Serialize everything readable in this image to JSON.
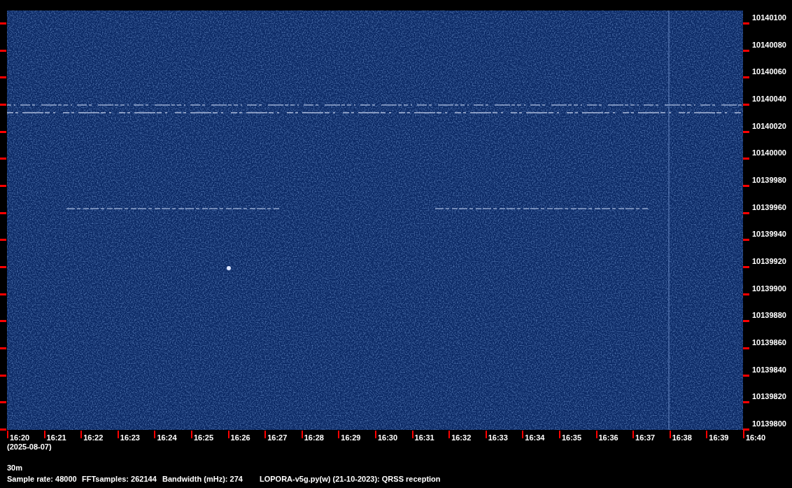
{
  "frequency_labels": [
    "10140100",
    "10140080",
    "10140060",
    "10140040",
    "10140020",
    "10140000",
    "10139980",
    "10139960",
    "10139940",
    "10139920",
    "10139900",
    "10139880",
    "10139860",
    "10139840",
    "10139820",
    "10139800"
  ],
  "time_labels": [
    "16:20",
    "16:21",
    "16:22",
    "16:23",
    "16:24",
    "16:25",
    "16:26",
    "16:27",
    "16:28",
    "16:29",
    "16:30",
    "16:31",
    "16:32",
    "16:33",
    "16:34",
    "16:35",
    "16:36",
    "16:37",
    "16:38",
    "16:39",
    "16:40"
  ],
  "date": "(2025-08-07)",
  "band": "30m",
  "info": [
    "Sample rate: 48000",
    "FFTsamples: 262144",
    "Bandwidth (mHz): 274",
    "LOPORA-v5g.py(w) (21-10-2023): QRSS reception"
  ]
}
